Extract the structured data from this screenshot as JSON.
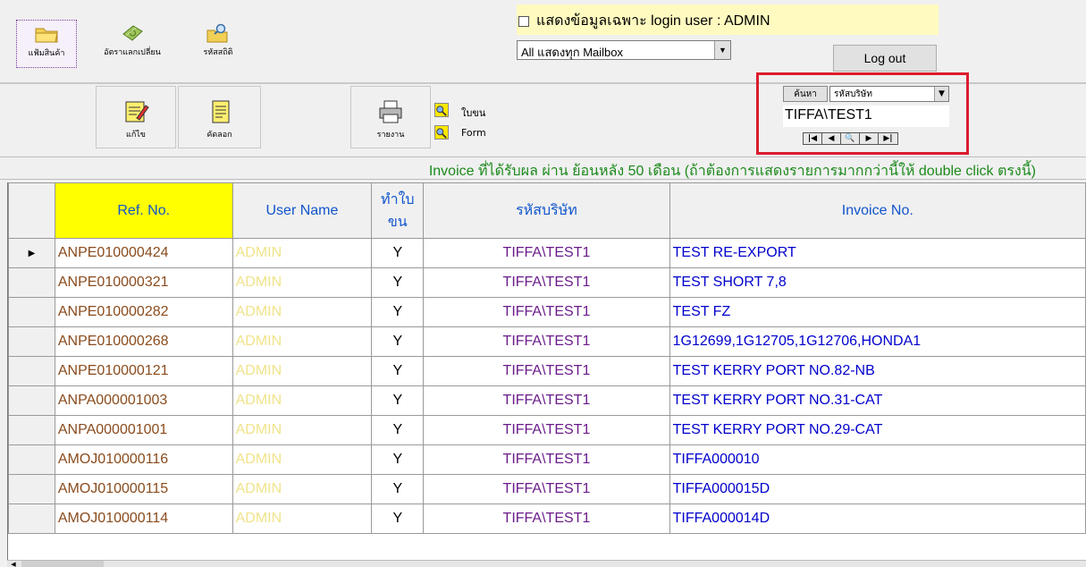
{
  "toolbar": {
    "buttons": [
      {
        "label": "แฟ้มสินค้า",
        "icon": "folder-icon"
      },
      {
        "label": "อัตราแลกเปลี่ยน",
        "icon": "money-icon"
      },
      {
        "label": "รหัสสถิติ",
        "icon": "folder-search-icon"
      }
    ]
  },
  "login": {
    "checkbox_label": "แสดงข้อมูลเฉพาะ login user : ADMIN",
    "mailbox_value": "All แสดงทุก Mailbox",
    "logout_label": "Log out"
  },
  "actions": {
    "edit_label": "แก้ไข",
    "copy_label": "คัดลอก",
    "report_label": "รายงาน",
    "option1_label": "ใบขน",
    "option2_label": "Form"
  },
  "search": {
    "button_label": "ค้นหา",
    "field_value": "รหัสบริษัท",
    "text_value": "TIFFA\\TEST1",
    "nav": [
      "|◀",
      "◀",
      "🔍",
      "▶",
      "▶|"
    ]
  },
  "info_message": "Invoice ที่ได้รับผล ผ่าน ย้อนหลัง 50 เดือน (ถ้าต้องการแสดงรายการมากกว่านี้ให้ double click ตรงนี้)",
  "grid": {
    "headers": {
      "ref": "Ref. No.",
      "user": "User Name",
      "status_line1": "ทำใบ",
      "status_line2": "ขน",
      "company": "รหัสบริษัท",
      "invoice": "Invoice No."
    },
    "rows": [
      {
        "ref": "ANPE010000424",
        "user": "ADMIN",
        "status": "Y",
        "company": "TIFFA\\TEST1",
        "invoice": "TEST RE-EXPORT",
        "current": "▶"
      },
      {
        "ref": "ANPE010000321",
        "user": "ADMIN",
        "status": "Y",
        "company": "TIFFA\\TEST1",
        "invoice": "TEST SHORT 7,8",
        "current": ""
      },
      {
        "ref": "ANPE010000282",
        "user": "ADMIN",
        "status": "Y",
        "company": "TIFFA\\TEST1",
        "invoice": "TEST FZ",
        "current": ""
      },
      {
        "ref": "ANPE010000268",
        "user": "ADMIN",
        "status": "Y",
        "company": "TIFFA\\TEST1",
        "invoice": "1G12699,1G12705,1G12706,HONDA1",
        "current": ""
      },
      {
        "ref": "ANPE010000121",
        "user": "ADMIN",
        "status": "Y",
        "company": "TIFFA\\TEST1",
        "invoice": "TEST KERRY PORT NO.82-NB",
        "current": ""
      },
      {
        "ref": "ANPA000001003",
        "user": "ADMIN",
        "status": "Y",
        "company": "TIFFA\\TEST1",
        "invoice": "TEST KERRY PORT NO.31-CAT",
        "current": ""
      },
      {
        "ref": "ANPA000001001",
        "user": "ADMIN",
        "status": "Y",
        "company": "TIFFA\\TEST1",
        "invoice": "TEST KERRY PORT NO.29-CAT",
        "current": ""
      },
      {
        "ref": "AMOJ010000116",
        "user": "ADMIN",
        "status": "Y",
        "company": "TIFFA\\TEST1",
        "invoice": "TIFFA000010",
        "current": ""
      },
      {
        "ref": "AMOJ010000115",
        "user": "ADMIN",
        "status": "Y",
        "company": "TIFFA\\TEST1",
        "invoice": "TIFFA000015D",
        "current": ""
      },
      {
        "ref": "AMOJ010000114",
        "user": "ADMIN",
        "status": "Y",
        "company": "TIFFA\\TEST1",
        "invoice": "TIFFA000014D",
        "current": ""
      }
    ]
  },
  "colors": {
    "header_highlight": "#ffff00",
    "info_text": "#1c8a1c",
    "ref_text": "#8a4b1d",
    "company_text": "#6a1b8a",
    "invoice_text": "#0000cc",
    "user_text": "#f0e38a",
    "annotation_frame": "#dc1c2c"
  }
}
